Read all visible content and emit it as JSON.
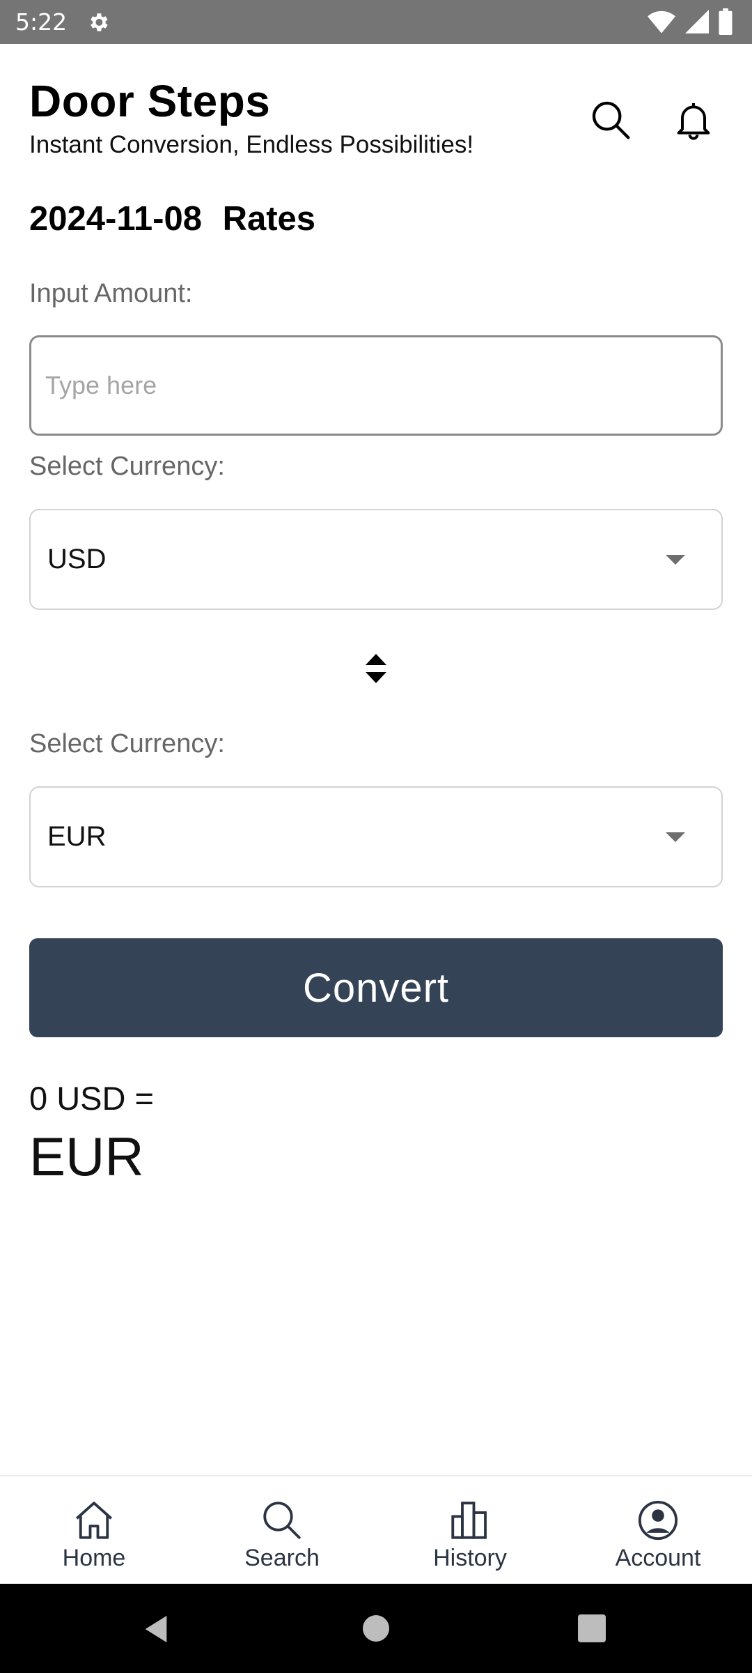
{
  "status_bar": {
    "time": "5:22"
  },
  "header": {
    "title": "Door Steps",
    "tagline": "Instant Conversion, Endless Possibilities!"
  },
  "rates": {
    "date": "2024-11-08",
    "label": "Rates"
  },
  "form": {
    "amount_label": "Input Amount:",
    "amount_placeholder": "Type here",
    "amount_value": "",
    "from_label": "Select Currency:",
    "from_currency": "USD",
    "to_label": "Select Currency:",
    "to_currency": "EUR",
    "convert_label": "Convert"
  },
  "result": {
    "line": "0 USD =",
    "currency": "EUR"
  },
  "bottom_nav": [
    {
      "label": "Home",
      "icon": "home-icon"
    },
    {
      "label": "Search",
      "icon": "search-icon"
    },
    {
      "label": "History",
      "icon": "bar-chart-icon"
    },
    {
      "label": "Account",
      "icon": "account-icon"
    }
  ],
  "colors": {
    "primary_button": "#344356",
    "status_bar": "#757575"
  }
}
